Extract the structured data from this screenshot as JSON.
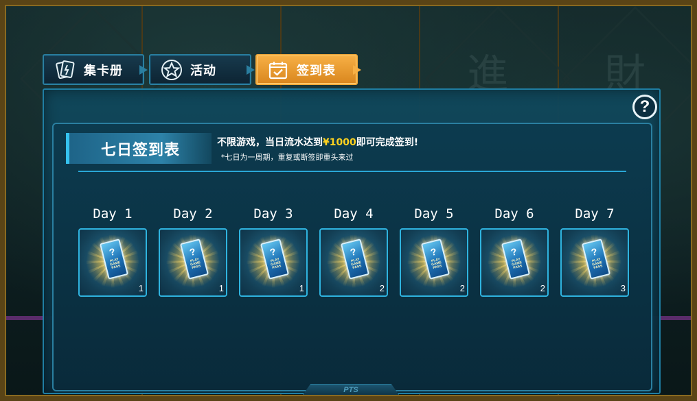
{
  "tabs": [
    {
      "label": "集卡册",
      "icon": "card-album-icon",
      "active": false
    },
    {
      "label": "活动",
      "icon": "star-icon",
      "active": false
    },
    {
      "label": "签到表",
      "icon": "calendar-check-icon",
      "active": true
    }
  ],
  "panel": {
    "title": "七日签到表",
    "rule_prefix": "不限游戏，当日流水达到",
    "rule_amount": "¥1000",
    "rule_suffix": "即可完成签到!",
    "rule_note": "*七日为一周期，重复或断签即重头来过",
    "help_label": "?"
  },
  "days": [
    {
      "label": "Day 1",
      "reward_icon": "card-pack-icon",
      "count": "1"
    },
    {
      "label": "Day 2",
      "reward_icon": "card-pack-icon",
      "count": "1"
    },
    {
      "label": "Day 3",
      "reward_icon": "card-pack-icon",
      "count": "1"
    },
    {
      "label": "Day 4",
      "reward_icon": "card-pack-icon",
      "count": "2"
    },
    {
      "label": "Day 5",
      "reward_icon": "card-pack-icon",
      "count": "2"
    },
    {
      "label": "Day 6",
      "reward_icon": "card-pack-icon",
      "count": "2"
    },
    {
      "label": "Day 7",
      "reward_icon": "card-pack-icon",
      "count": "3"
    }
  ],
  "card_pack": {
    "symbol": "?",
    "line1": "PLAY GAME",
    "line2": "PASS"
  },
  "footer_tab": "PTS",
  "background_glyphs": [
    "進",
    "財"
  ],
  "colors": {
    "accent": "#2fb4e0",
    "active_tab": "#f7b045",
    "amount": "#ffd21f",
    "panel": "#10485c"
  }
}
